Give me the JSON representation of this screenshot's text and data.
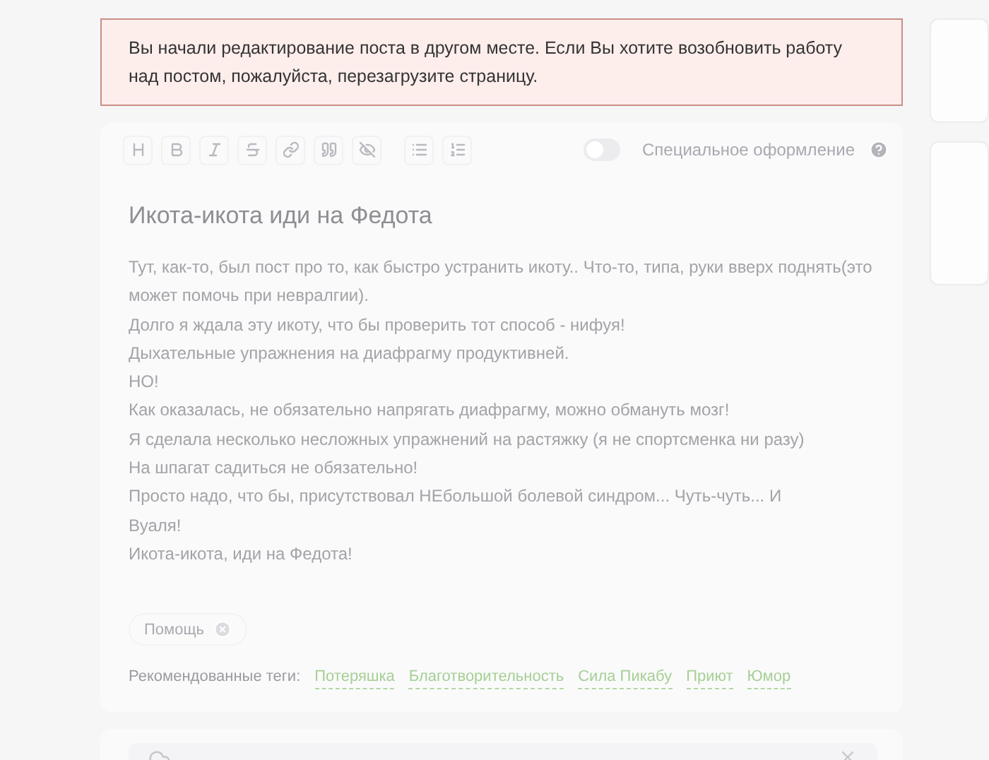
{
  "alert": {
    "text": "Вы начали редактирование поста в другом месте. Если Вы хотите возобновить работу над постом, пожалуйста, перезагрузите страницу."
  },
  "toolbar": {
    "tools": [
      {
        "kind": "heading"
      },
      {
        "kind": "bold"
      },
      {
        "kind": "italic"
      },
      {
        "kind": "strike"
      },
      {
        "kind": "link"
      },
      {
        "kind": "quote"
      },
      {
        "kind": "spoiler"
      },
      {
        "kind": "bullets"
      },
      {
        "kind": "numbers"
      }
    ],
    "special_toggle": {
      "label": "Специальное оформление",
      "on": false
    }
  },
  "post": {
    "title": "Икота-икота иди на Федота",
    "lines": [
      "Тут, как-то, был пост про то, как быстро устранить икоту.. Что-то, типа, руки вверх поднять(это может помочь при невралгии).",
      "Долго я ждала эту икоту, что бы проверить тот способ - нифуя!",
      "Дыхательные упражнения на диафрагму продуктивней.",
      "НО!",
      "Как оказалась, не обязательно напрягать диафрагму, можно обмануть мозг!",
      "Я сделала несколько несложных упражнений на растяжку (я не спортсменка ни разу)",
      "На шпагат садиться не обязательно!",
      "Просто надо, что бы, присутствовал НЕбольшой болевой синдром... Чуть-чуть... И",
      "Вуаля!",
      "Икота-икота, иди на Федота!"
    ]
  },
  "tags": [
    "Помощь"
  ],
  "recommended": {
    "label": "Рекомендованные теги:",
    "tags": [
      "Потеряшка",
      "Благотворительность",
      "Сила Пикабу",
      "Приют",
      "Юмор"
    ]
  }
}
